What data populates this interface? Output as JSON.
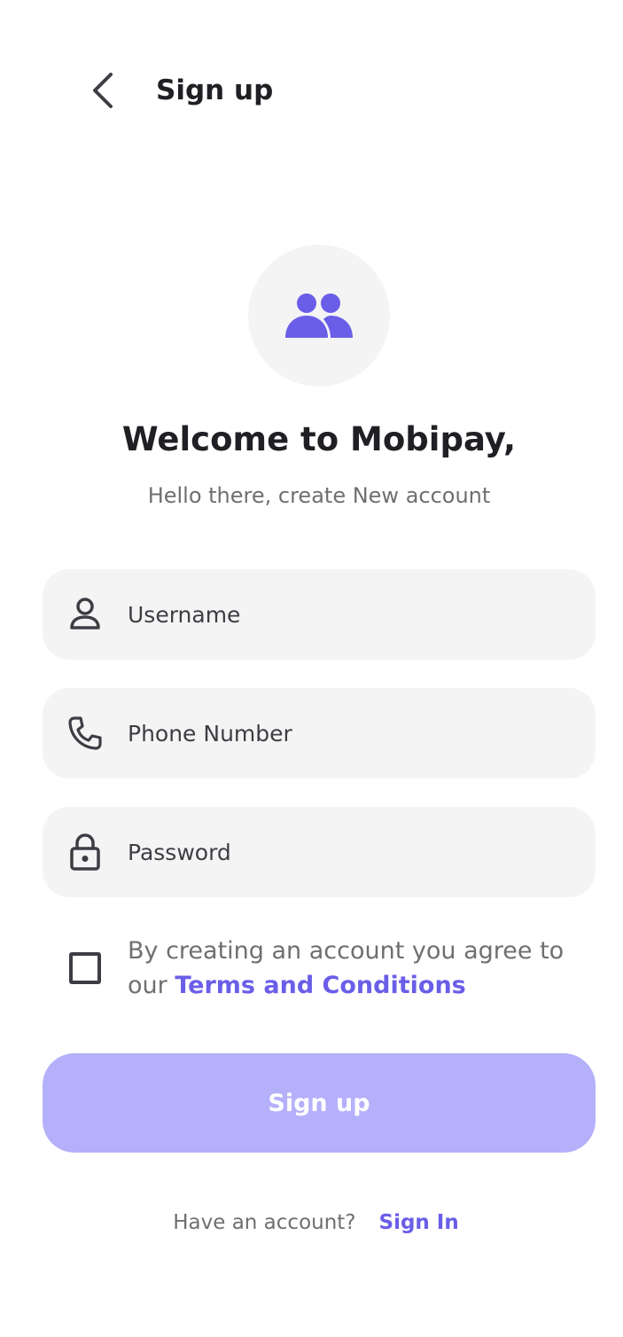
{
  "header": {
    "title": "Sign up"
  },
  "hero": {
    "icon": "group-users-icon",
    "title": "Welcome to Mobipay,",
    "subtitle": "Hello there, create New account"
  },
  "form": {
    "username": {
      "placeholder": "Username",
      "value": "",
      "icon": "person-icon"
    },
    "phone": {
      "placeholder": "Phone Number",
      "value": "",
      "icon": "phone-icon"
    },
    "password": {
      "placeholder": "Password",
      "value": "",
      "icon": "lock-icon"
    },
    "terms": {
      "checked": false,
      "text": "By creating an account you agree to our ",
      "link": "Terms and Conditions"
    },
    "submit_label": "Sign up"
  },
  "footer": {
    "question": "Have an account?",
    "link": "Sign In"
  },
  "colors": {
    "accent": "#6a5ee8",
    "button_disabled": "#b4b0fa",
    "field_bg": "#f4f4f4",
    "text_dark": "#1f1f24",
    "text_muted": "#6f6f72"
  }
}
